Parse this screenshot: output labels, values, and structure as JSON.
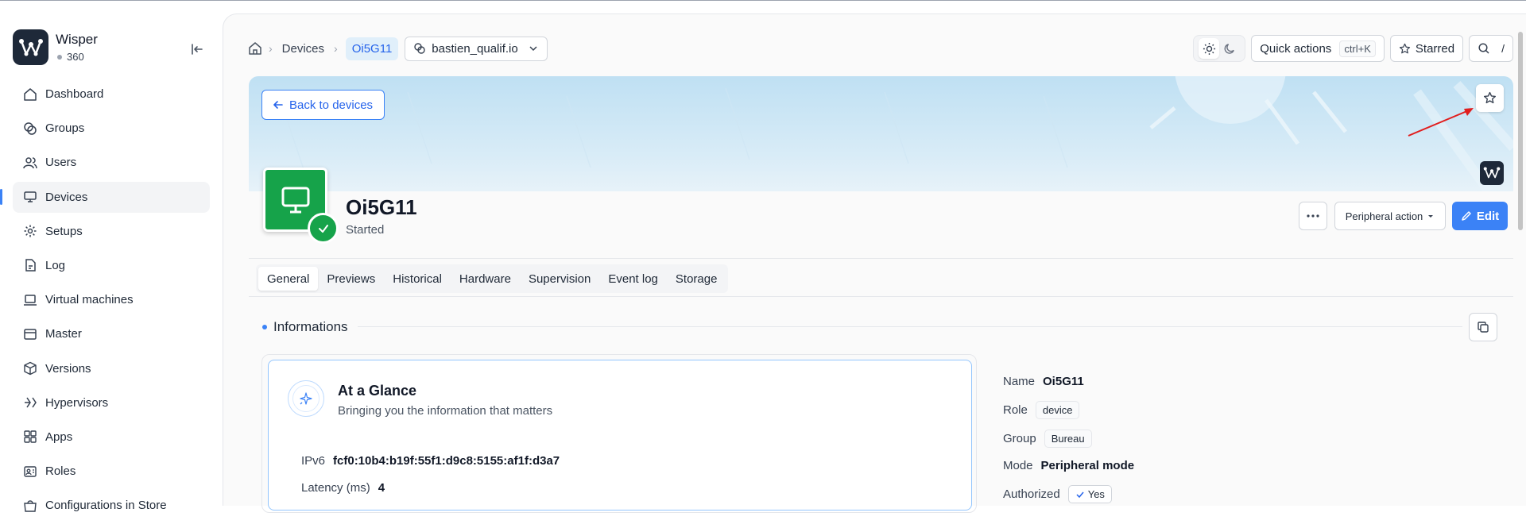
{
  "sidebar": {
    "app_name": "Wisper",
    "count": "360",
    "items": [
      {
        "label": "Dashboard"
      },
      {
        "label": "Groups"
      },
      {
        "label": "Users"
      },
      {
        "label": "Devices"
      },
      {
        "label": "Setups"
      },
      {
        "label": "Log"
      },
      {
        "label": "Virtual machines"
      },
      {
        "label": "Master"
      },
      {
        "label": "Versions"
      },
      {
        "label": "Hypervisors"
      },
      {
        "label": "Apps"
      },
      {
        "label": "Roles"
      },
      {
        "label": "Configurations in Store"
      }
    ],
    "active_item": "Devices"
  },
  "breadcrumb": {
    "devices": "Devices",
    "current": "Oi5G11",
    "workspace": "bastien_qualif.io"
  },
  "toolbar": {
    "quick_actions": "Quick actions",
    "quick_actions_kbd": "ctrl+K",
    "starred": "Starred",
    "search_kbd": "/"
  },
  "banner": {
    "back_label": "Back to devices"
  },
  "device": {
    "name": "Oi5G11",
    "status": "Started",
    "peripheral_action": "Peripheral action",
    "edit": "Edit"
  },
  "tabs": [
    "General",
    "Previews",
    "Historical",
    "Hardware",
    "Supervision",
    "Event log",
    "Storage"
  ],
  "active_tab": "General",
  "section": {
    "title": "Informations"
  },
  "glance": {
    "title": "At a Glance",
    "subtitle": "Bringing you the information that matters",
    "ipv6_label": "IPv6",
    "ipv6_value": "fcf0:10b4:b19f:55f1:d9c8:5155:af1f:d3a7",
    "latency_label": "Latency (ms)",
    "latency_value": "4"
  },
  "details": {
    "name_label": "Name",
    "name_value": "Oi5G11",
    "role_label": "Role",
    "role_value": "device",
    "group_label": "Group",
    "group_value": "Bureau",
    "mode_label": "Mode",
    "mode_value": "Peripheral mode",
    "authorized_label": "Authorized",
    "authorized_value": "Yes"
  },
  "colors": {
    "accent": "#3b82f6",
    "success": "#16a34a",
    "annotation_arrow": "#e11d1d"
  }
}
